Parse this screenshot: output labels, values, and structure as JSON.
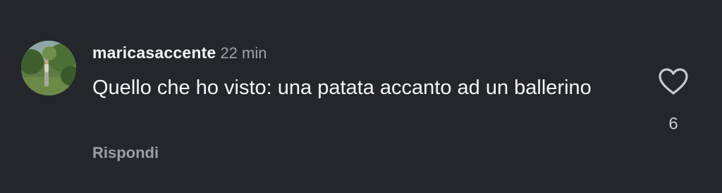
{
  "comment": {
    "username": "maricasaccente",
    "timestamp": "22 min",
    "text": "Quello che ho visto: una patata accanto ad un ballerino",
    "reply_label": "Rispondi",
    "like_count": "6",
    "avatar_icon": "user-avatar-photo",
    "like_icon": "heart-outline-icon"
  },
  "colors": {
    "background": "#24262c",
    "primary_text": "#f4f5f7",
    "secondary_text": "#9da1a9"
  }
}
